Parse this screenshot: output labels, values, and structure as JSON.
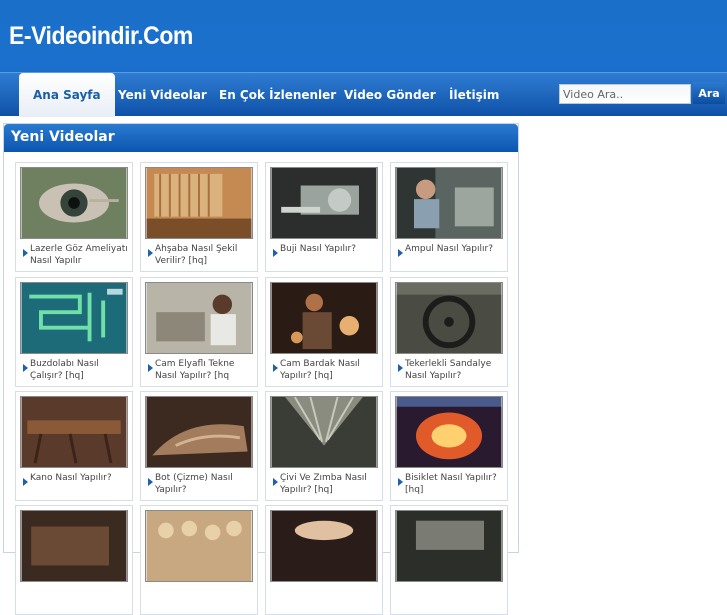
{
  "site": {
    "logo": "E-Videoindir.Com"
  },
  "nav": [
    {
      "label": "Ana Sayfa",
      "active": true
    },
    {
      "label": "Yeni Videolar"
    },
    {
      "label": "En Çok İzlenenler"
    },
    {
      "label": "Video Gönder"
    },
    {
      "label": "İletişim"
    }
  ],
  "search": {
    "placeholder": "Video Ara..",
    "value": "Video Ara..",
    "button_label": "Ara"
  },
  "section": {
    "title": "Yeni Videolar"
  },
  "videos": [
    {
      "title": "Lazerle Göz Ameliyatı Nasıl Yapılır"
    },
    {
      "title": "Ahşaba Nasıl Şekil Verilir? [hq]"
    },
    {
      "title": "Buji Nasıl Yapılır?"
    },
    {
      "title": "Ampul Nasıl Yapılır?"
    },
    {
      "title": "Buzdolabı Nasıl Çalışır? [hq]"
    },
    {
      "title": "Cam Elyaflı Tekne Nasıl Yapılır? [hq"
    },
    {
      "title": "Cam Bardak Nasıl Yapılır? [hq]"
    },
    {
      "title": "Tekerlekli Sandalye Nasıl Yapılır?"
    },
    {
      "title": "Kano Nasıl Yapılır?"
    },
    {
      "title": "Bot (Çizme) Nasıl Yapılır?"
    },
    {
      "title": "Çivi Ve Zımba Nasıl Yapılır? [hq]"
    },
    {
      "title": "Bisiklet Nasıl Yapılır? [hq]"
    }
  ],
  "colors": {
    "brand_blue": "#1a6fc8",
    "nav_dark": "#0e52a8",
    "caption_text": "#444444"
  }
}
